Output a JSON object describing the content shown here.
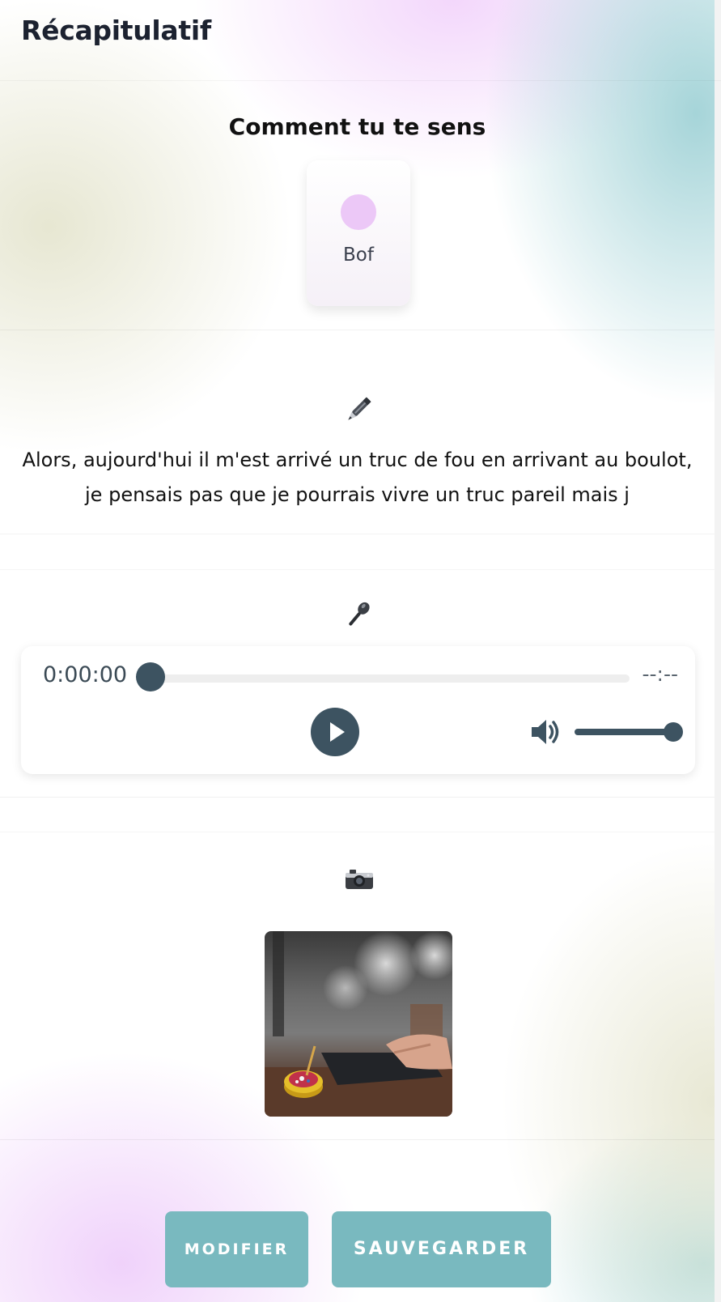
{
  "header": {
    "title": "Récapitulatif"
  },
  "mood": {
    "title": "Comment tu te sens",
    "label": "Bof",
    "color": "#ecc8f7"
  },
  "note": {
    "icon": "pen-icon",
    "text": "Alors, aujourd'hui il m'est arrivé un truc de fou en arrivant au boulot, je pensais pas que je pourrais vivre un truc pareil mais j"
  },
  "audio": {
    "icon": "microphone-icon",
    "current_time": "0:00:00",
    "duration": "--:--",
    "progress": 0,
    "volume": 1,
    "accent": "#3d5361"
  },
  "photo": {
    "icon": "camera-icon"
  },
  "actions": {
    "modify_label": "MODIFIER",
    "save_label": "SAUVEGARDER",
    "button_color": "#79b9bf"
  }
}
